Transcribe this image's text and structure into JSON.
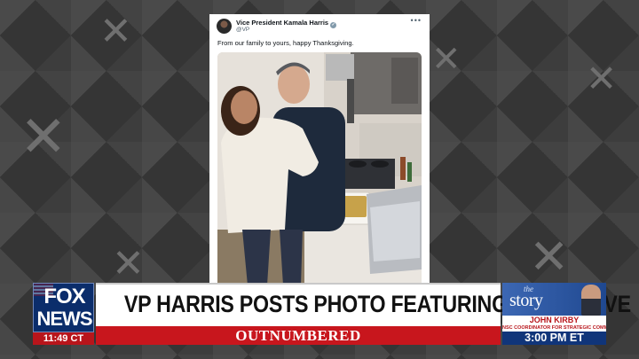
{
  "background": {
    "icon": "x-logo-icon"
  },
  "tweet": {
    "author_name": "Vice President Kamala Harris",
    "handle": "@VP",
    "more_icon": "more-dots-icon",
    "verified_icon": "verified-badge-icon",
    "text": "From our family to yours, happy Thanksgiving."
  },
  "lower_third": {
    "network_logo_line1": "FOX",
    "network_logo_line2": "NEWS",
    "clock": "11:49 CT",
    "headline": "VP HARRIS POSTS PHOTO FEATURING GAS STOVE",
    "show_name": "OUTNUMBERED",
    "promo": {
      "show_the": "the",
      "show_story": "story",
      "guest_name": "JOHN KIRBY",
      "guest_title": "NSC COORDINATOR FOR STRATEGIC COMMUNICATIONS",
      "time": "3:00 PM ET"
    }
  },
  "colors": {
    "fox_blue": "#0b2d6b",
    "fox_red": "#c8161d",
    "background": "#3a3a3a"
  }
}
